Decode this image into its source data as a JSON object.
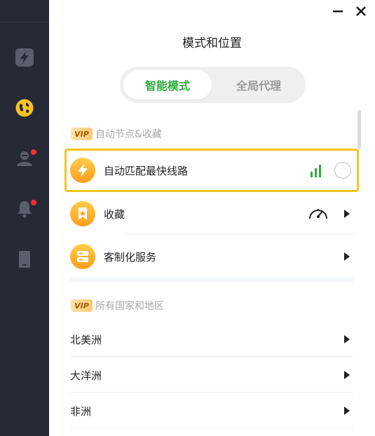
{
  "window": {
    "minimize_icon": "minimize-icon",
    "close_icon": "close-icon"
  },
  "sidebar": {
    "items": [
      {
        "icon": "lightning-icon",
        "badge": false
      },
      {
        "icon": "globe-icon",
        "active": true,
        "badge": false
      },
      {
        "icon": "user-icon",
        "badge": true
      },
      {
        "icon": "bell-icon",
        "badge": true
      },
      {
        "icon": "device-icon",
        "badge": false
      }
    ]
  },
  "header": {
    "title": "模式和位置"
  },
  "mode_switch": {
    "active": "智能模式",
    "inactive": "全局代理"
  },
  "auto_section": {
    "vip": "VIP",
    "label": "自动节点&收藏",
    "items": [
      {
        "label": "自动匹配最快线路",
        "selected": false
      },
      {
        "label": "收藏"
      },
      {
        "label": "客制化服务"
      }
    ]
  },
  "region_section": {
    "vip": "VIP",
    "label": "所有国家和地区",
    "items": [
      {
        "label": "北美洲"
      },
      {
        "label": "大洋洲"
      },
      {
        "label": "非洲"
      }
    ]
  },
  "colors": {
    "sidebar_bg": "#262a36",
    "accent_green": "#2fae3a",
    "highlight_border": "#f7c31f",
    "icon_orange": "#ffb02e",
    "badge_red": "#ff2d2d"
  }
}
